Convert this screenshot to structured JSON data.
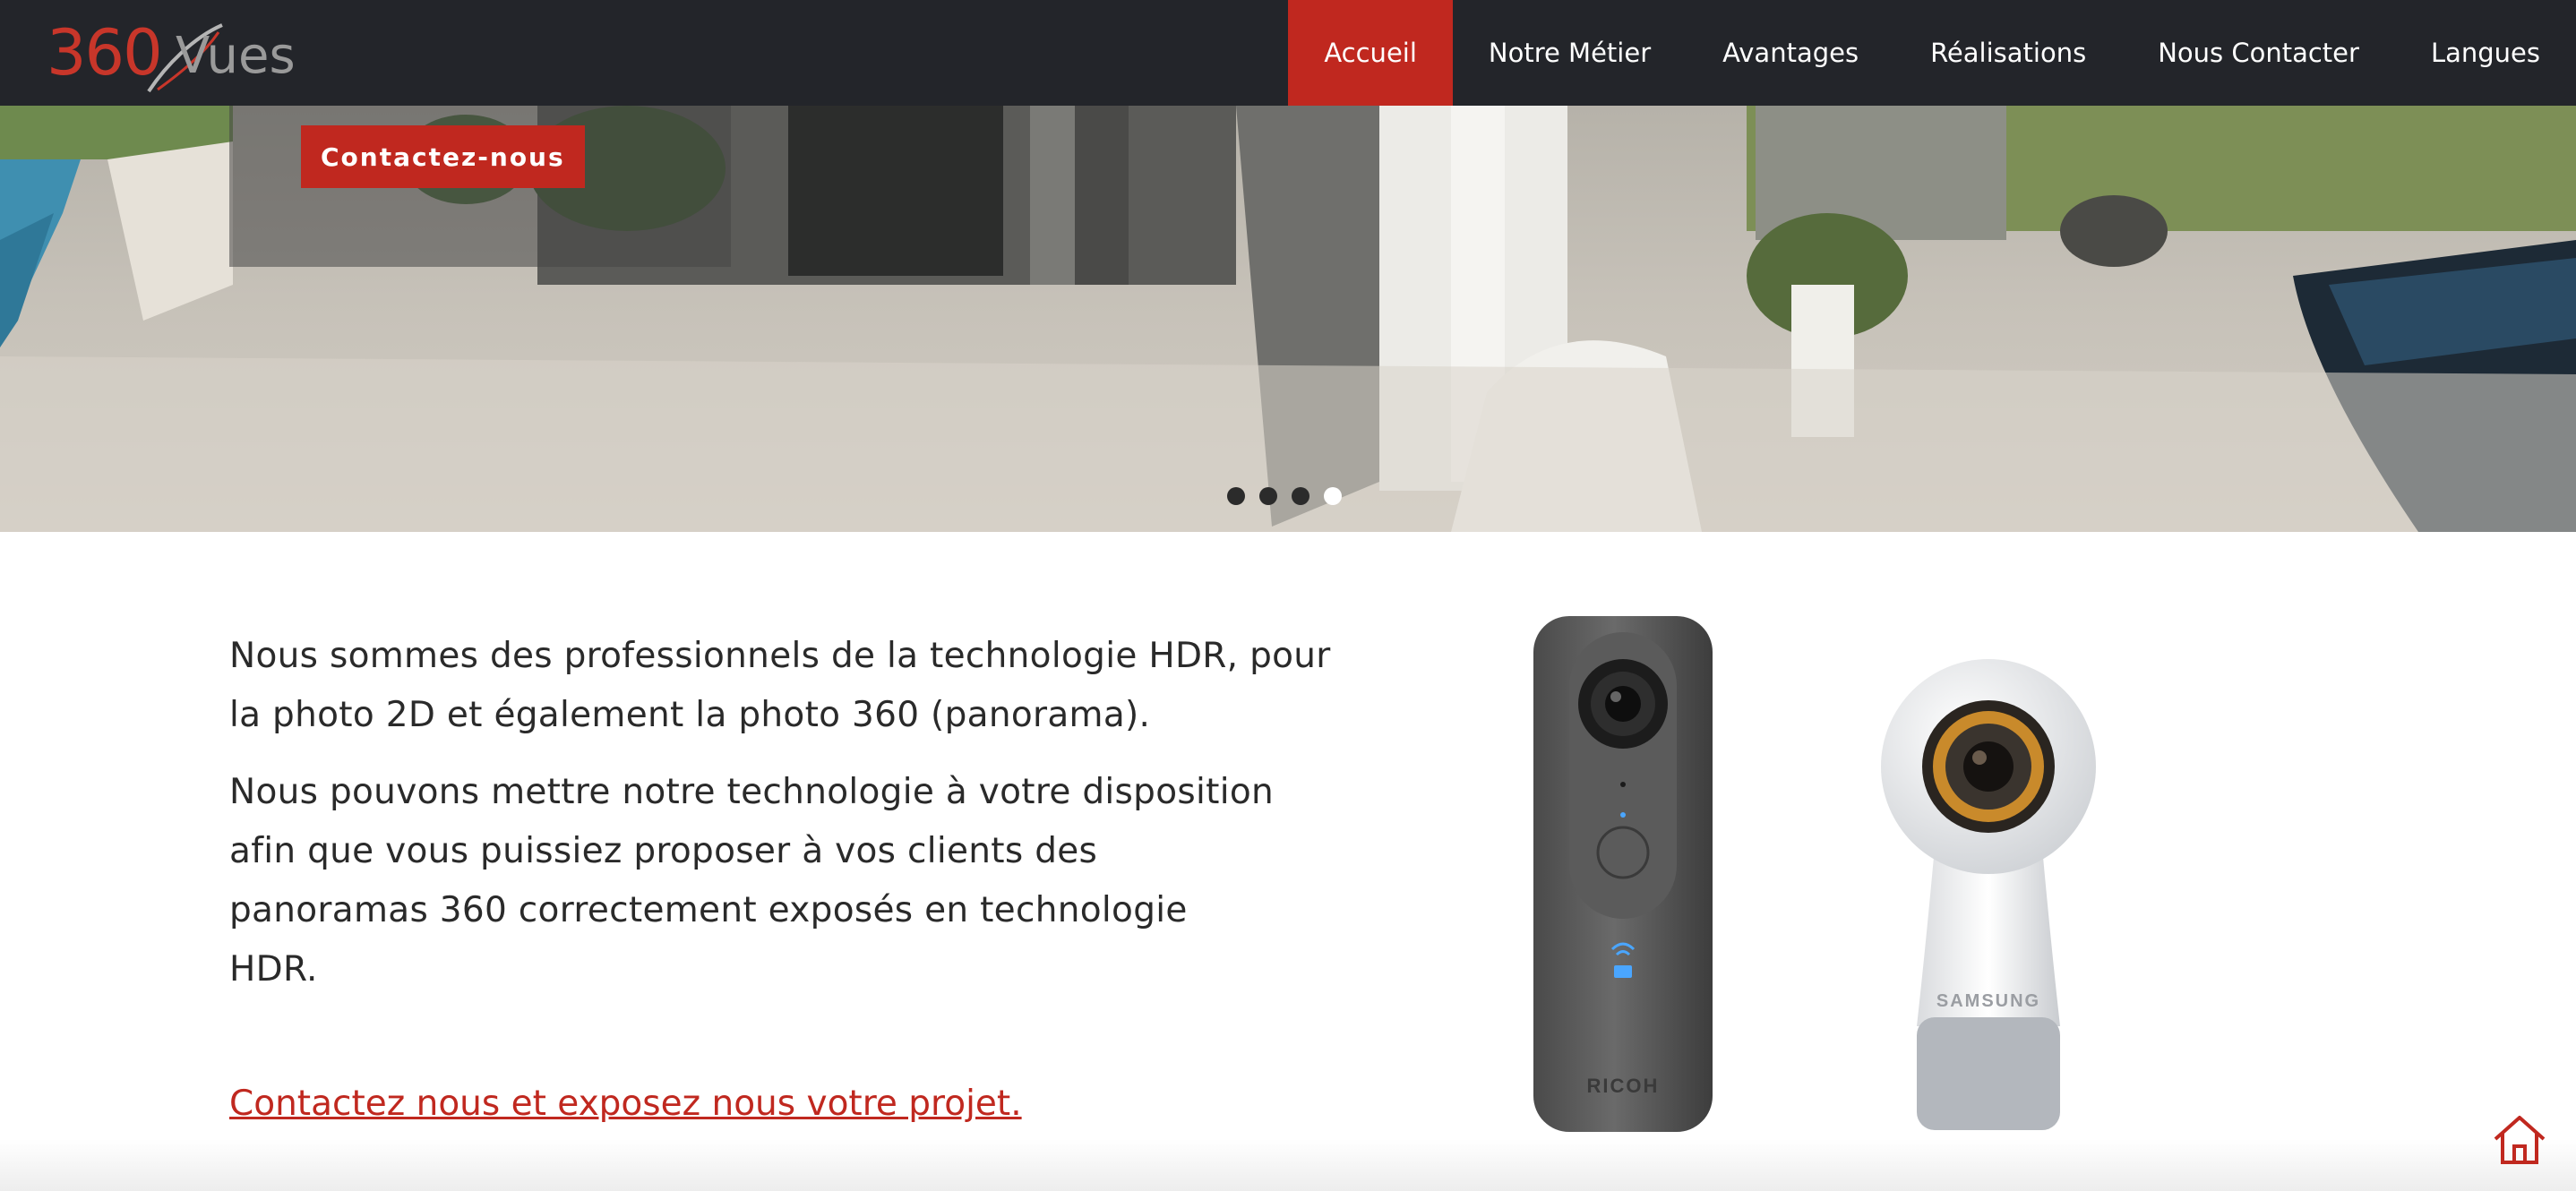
{
  "brand": {
    "logo_number": "360",
    "logo_word": "Vues"
  },
  "nav": {
    "items": [
      {
        "label": "Accueil",
        "active": true
      },
      {
        "label": "Notre Métier",
        "active": false
      },
      {
        "label": "Avantages",
        "active": false
      },
      {
        "label": "Réalisations",
        "active": false
      },
      {
        "label": "Nous Contacter",
        "active": false
      },
      {
        "label": "Langues",
        "active": false
      }
    ]
  },
  "hero": {
    "cta_label": "Contactez-nous",
    "slides_count": 4,
    "active_slide": 4
  },
  "intro": {
    "paragraph_1": "Nous sommes des professionnels de la technologie HDR, pour la photo 2D et également la photo 360 (panorama).",
    "paragraph_2": "Nous pouvons mettre notre technologie à votre disposition afin que vous puissiez proposer à vos clients des panoramas 360 correctement exposés en technologie HDR.",
    "contact_link": "Contactez nous et exposez nous votre projet."
  },
  "products": {
    "camera_1_brand": "RICOH",
    "camera_2_brand": "SAMSUNG"
  },
  "colors": {
    "header_bg": "#23252a",
    "accent": "#c0281f",
    "text": "#2a2a2a",
    "logo_grey": "#9a9a9a"
  },
  "icons": [
    "home-icon",
    "wifi-icon",
    "camera-icon"
  ]
}
